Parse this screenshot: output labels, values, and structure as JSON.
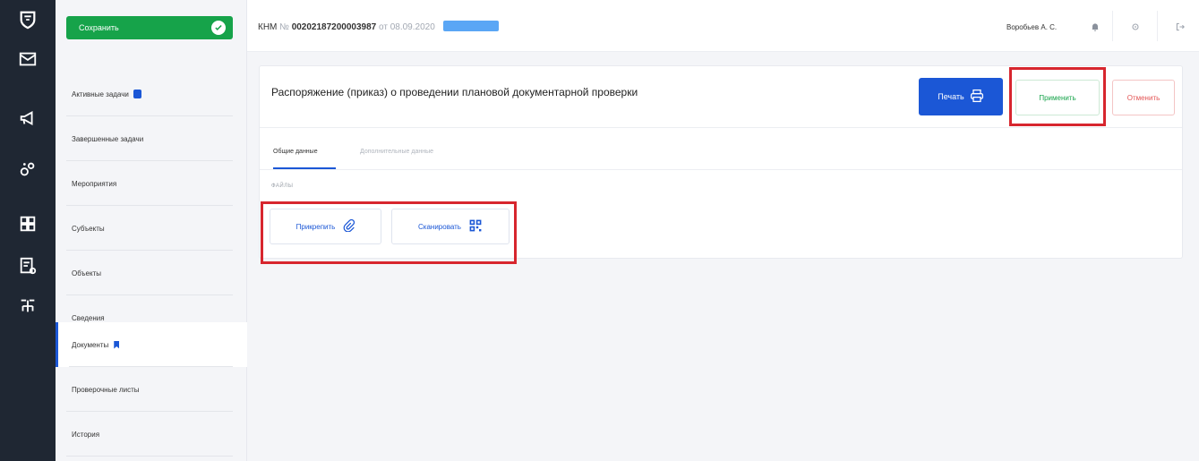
{
  "rail": {
    "icons": [
      "logo-shield-icon",
      "mail-icon",
      "megaphone-icon",
      "gears-icon",
      "grid-icon",
      "report-icon",
      "org-structure-icon"
    ]
  },
  "sidebar": {
    "save_label": "Сохранить",
    "items": [
      {
        "label": "Активные задачи",
        "has_badge": true
      },
      {
        "label": "Завершенные задачи"
      },
      {
        "label": "Мероприятия"
      },
      {
        "label": "Субъекты"
      },
      {
        "label": "Объекты"
      },
      {
        "label": "Сведения"
      },
      {
        "label": "Документы",
        "active": true,
        "bookmark": true
      },
      {
        "label": "Проверочные листы"
      },
      {
        "label": "История"
      }
    ]
  },
  "header": {
    "type": "КНМ",
    "number_prefix": "№",
    "number": "00202187200003987",
    "date_text": "от 08.09.2020",
    "user": "Воробьев А. С.",
    "icons": [
      "bell-icon",
      "settings-icon",
      "logout-icon"
    ]
  },
  "document": {
    "title": "Распоряжение (приказ) о проведении плановой документарной проверки",
    "print_label": "Печать",
    "apply_label": "Применить",
    "cancel_label": "Отменить",
    "tabs": [
      "Общие данные",
      "Дополнительные данные"
    ],
    "files_label": "ФАЙЛЫ",
    "attach_label": "Прикрепить",
    "scan_label": "Сканировать"
  },
  "colors": {
    "accent": "#1b57d6",
    "success": "#16a34a",
    "danger": "#e35555",
    "highlight": "#d7262e",
    "rail": "#1f2733"
  }
}
